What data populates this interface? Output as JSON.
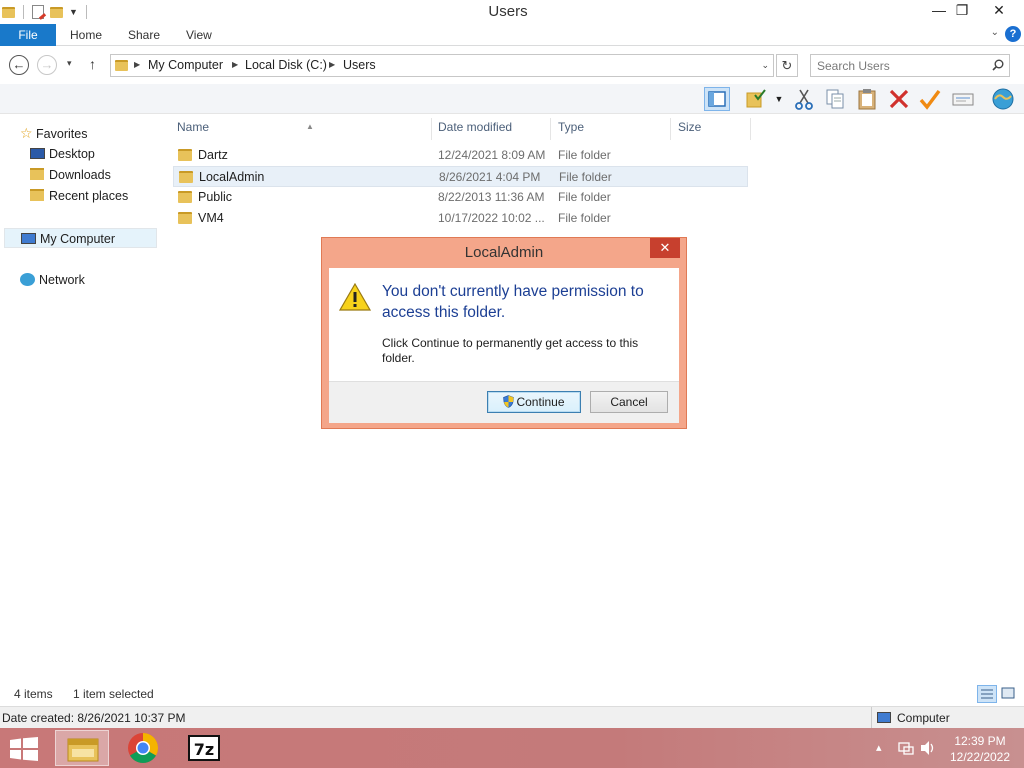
{
  "window": {
    "title": "Users",
    "minimize": "—",
    "restore": "❐",
    "close": "✕"
  },
  "ribbon": {
    "tabs": [
      "File",
      "Home",
      "Share",
      "View"
    ],
    "collapse_chevron": "⌄",
    "help": "?"
  },
  "address_bar": {
    "back": "←",
    "forward": "→",
    "recent_dropdown": "▾",
    "up": "↑",
    "crumbs": [
      "My Computer",
      "Local Disk (C:)",
      "Users"
    ],
    "dropdown": "⌄",
    "refresh": "↻"
  },
  "search": {
    "placeholder": "Search Users"
  },
  "nav_pane": {
    "items": [
      "Favorites",
      "Desktop",
      "Downloads",
      "Recent places",
      "My Computer",
      "Network"
    ]
  },
  "file_list": {
    "columns": [
      "Name",
      "Date modified",
      "Type",
      "Size"
    ],
    "rows": [
      {
        "name": "Dartz",
        "date": "12/24/2021 8:09 AM",
        "type": "File folder"
      },
      {
        "name": "LocalAdmin",
        "date": "8/26/2021 4:04 PM",
        "type": "File folder"
      },
      {
        "name": "Public",
        "date": "8/22/2013 11:36 AM",
        "type": "File folder"
      },
      {
        "name": "VM4",
        "date": "10/17/2022 10:02 ...",
        "type": "File folder"
      }
    ]
  },
  "status": {
    "item_count": "4 items",
    "selection": "1 item selected",
    "details": "Date created: 8/26/2021 10:37 PM",
    "location": "Computer"
  },
  "dialog": {
    "title": "LocalAdmin",
    "close": "✕",
    "message": "You don't currently have permission to access this folder.",
    "detail": "Click Continue to permanently get access to this folder.",
    "continue_label": "Continue",
    "cancel_label": "Cancel"
  },
  "taskbar": {
    "time": "12:39 PM",
    "date": "12/22/2022",
    "tray_arrow": "▴"
  },
  "colors": {
    "file_tab": "#1979ca",
    "dialog_frame": "#f4a68a",
    "dialog_heading": "#1c3f94",
    "taskbar": "#c47a7a"
  }
}
